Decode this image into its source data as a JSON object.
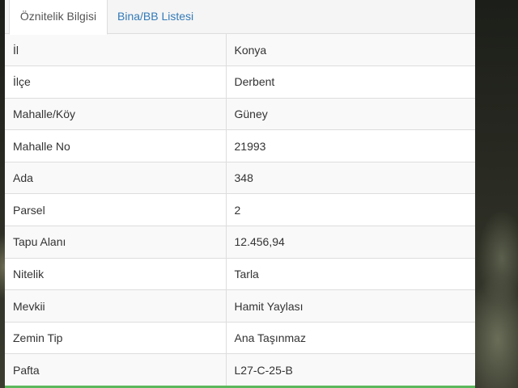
{
  "tabs": [
    {
      "label": "Öznitelik Bilgisi",
      "active": true
    },
    {
      "label": "Bina/BB Listesi",
      "active": false
    }
  ],
  "colors": {
    "link": "#337ab7",
    "stripe": "#f9f9f9",
    "border": "#dddddd",
    "accent_bar": "#5cb85c"
  },
  "rows": [
    {
      "key": "İl",
      "value": "Konya"
    },
    {
      "key": "İlçe",
      "value": "Derbent"
    },
    {
      "key": "Mahalle/Köy",
      "value": "Güney"
    },
    {
      "key": "Mahalle No",
      "value": "21993"
    },
    {
      "key": "Ada",
      "value": "348"
    },
    {
      "key": "Parsel",
      "value": "2"
    },
    {
      "key": "Tapu Alanı",
      "value": "12.456,94"
    },
    {
      "key": "Nitelik",
      "value": "Tarla"
    },
    {
      "key": "Mevkii",
      "value": "Hamit Yaylası"
    },
    {
      "key": "Zemin Tip",
      "value": "Ana Taşınmaz"
    },
    {
      "key": "Pafta",
      "value": "L27-C-25-B"
    }
  ]
}
